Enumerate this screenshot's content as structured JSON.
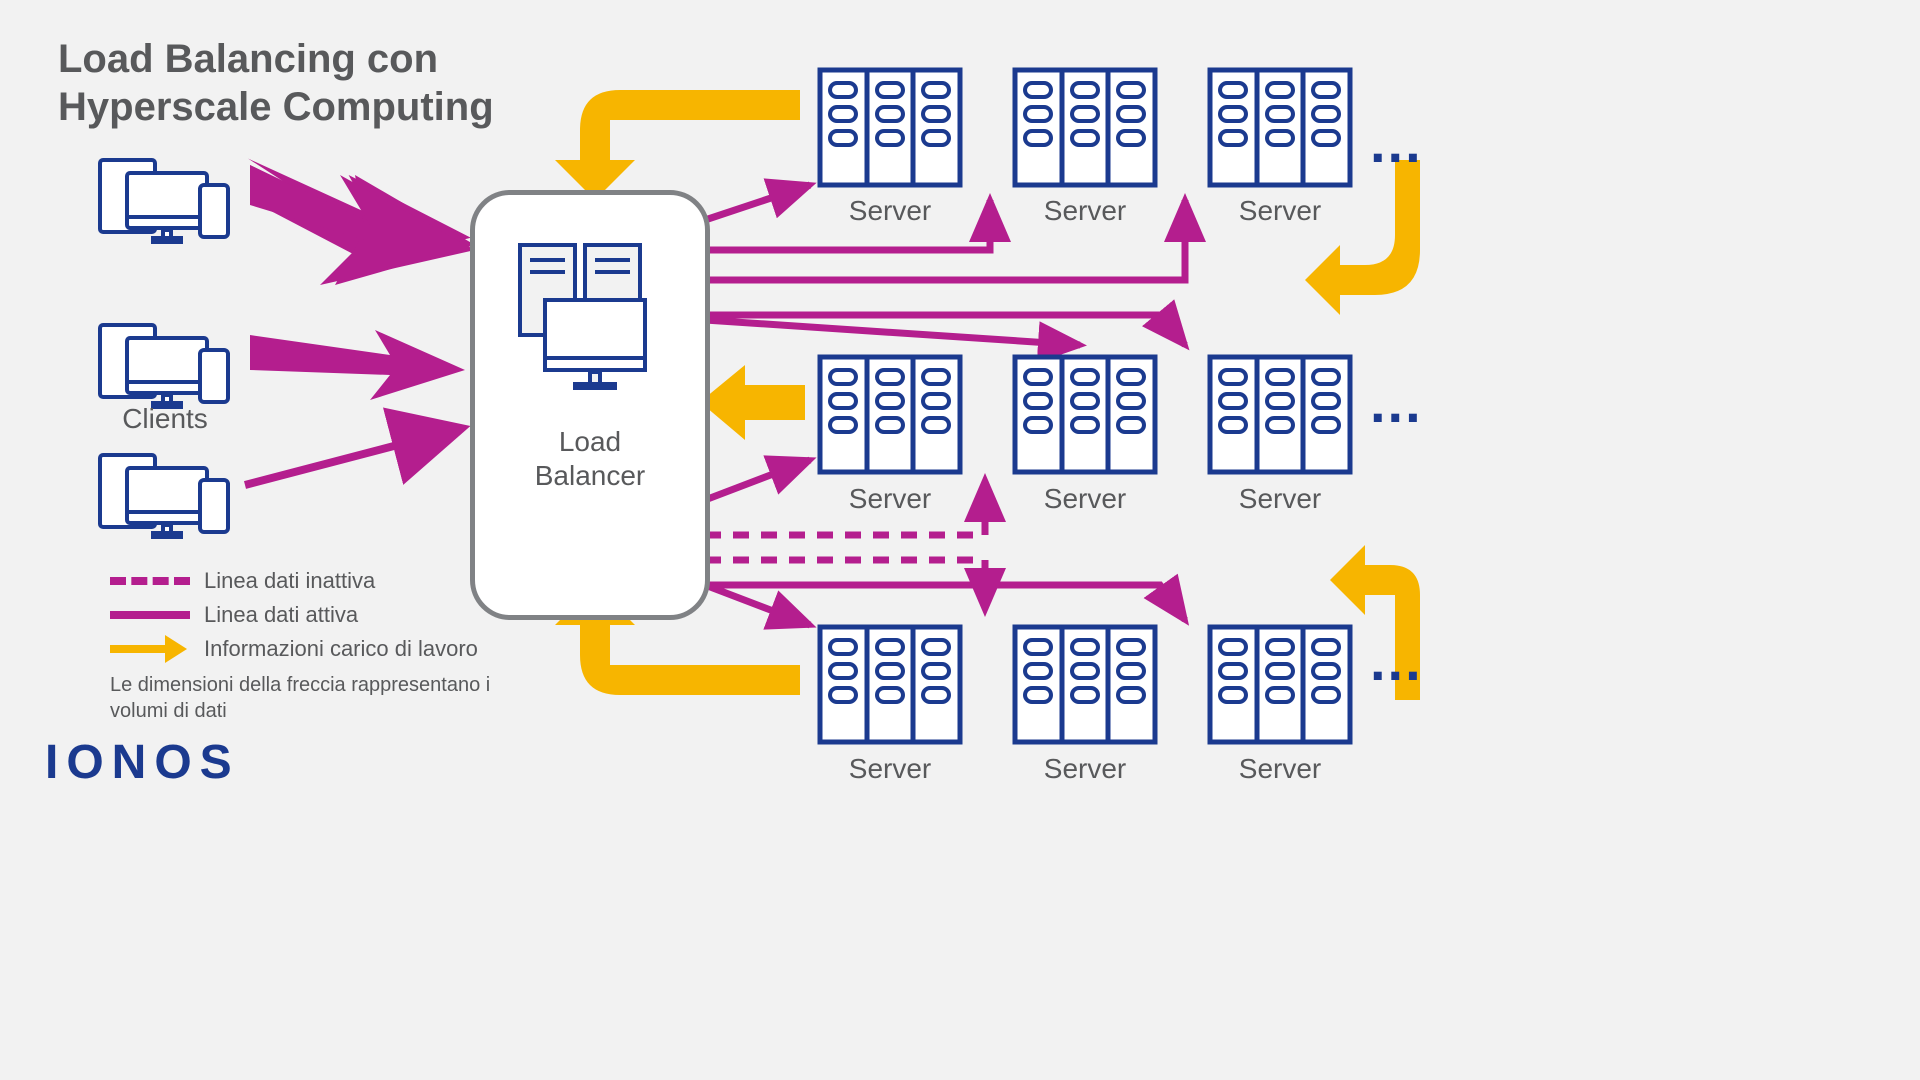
{
  "title": "Load Balancing con\nHyperscale Computing",
  "clients_label": "Clients",
  "lb_label": "Load\nBalancer",
  "server_label": "Server",
  "legend": {
    "inactive": "Linea dati inattiva",
    "active": "Linea dati attiva",
    "workload": "Informazioni carico di lavoro",
    "note": "Le dimensioni della freccia rappresentano i volumi di dati"
  },
  "logo": "IONOS",
  "colors": {
    "blue": "#1b3a8f",
    "magenta": "#b41e8e",
    "yellow": "#f7b500",
    "gray": "#58595b"
  },
  "ellipsis": "..."
}
